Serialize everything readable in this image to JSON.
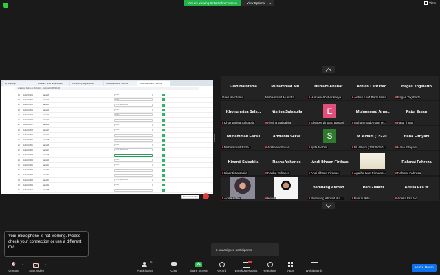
{
  "top": {
    "share_banner": "You are viewing Sinta Fahrur' screen",
    "view_options": "View Options",
    "view": "View"
  },
  "shared_screen": {
    "browser_tabs": [
      "(3) WhatsApp",
      "Dosdian - Sinta Tanya Scoveli",
      "OS tambungkungnatasi-rsa",
      "Universitas Bakrie - SIM Kis",
      "Universitas Bakrie - SIM Kis"
    ],
    "url": "academic.bakrie.ac.id/ubakrie_pim/nilai/10/4673/1200",
    "rows": [
      {
        "no": "16",
        "nim": "1202001001",
        "name": "Nama16",
        "select": "Lulus"
      },
      {
        "no": "17",
        "nim": "1202001002",
        "name": "Nama17",
        "select": "Lulus"
      },
      {
        "no": "18",
        "nim": "1202001003",
        "name": "Nama18",
        "select": "- Pilih Status Lulus -"
      },
      {
        "no": "19",
        "nim": "1202001004",
        "name": "Nama19",
        "select": "Lulus"
      },
      {
        "no": "20",
        "nim": "1202001005",
        "name": "Nama20",
        "select": "Lulus"
      },
      {
        "no": "21",
        "nim": "1202001006",
        "name": "Nama21",
        "select": "Lulus"
      },
      {
        "no": "22",
        "nim": "1202001007",
        "name": "Nama22",
        "select": "Lulus"
      },
      {
        "no": "23",
        "nim": "1202001008",
        "name": "Nama23",
        "select": "Lulus"
      },
      {
        "no": "24",
        "nim": "1202001009",
        "name": "Nama24",
        "select": "Lulus"
      },
      {
        "no": "25",
        "nim": "1202001010",
        "name": "Nama25",
        "select": "Lulus"
      },
      {
        "no": "26",
        "nim": "1202001011",
        "name": "Nama26",
        "select": "Lulus"
      },
      {
        "no": "27",
        "nim": "1202001012",
        "name": "Nama27",
        "select": "- Pilih Status Lulus -"
      },
      {
        "no": "28",
        "nim": "1202001013",
        "name": "Nama28",
        "select": "Lulus"
      },
      {
        "no": "29",
        "nim": "1202001014",
        "name": "Nama29",
        "select": "Lulus"
      },
      {
        "no": "30",
        "nim": "1202001015",
        "name": "Nama30",
        "select": "Lulus"
      },
      {
        "no": "31",
        "nim": "1202001016",
        "name": "Nama31",
        "select": "- Pilih Status Lulus -"
      },
      {
        "no": "32",
        "nim": "1202001017",
        "name": "Nama32",
        "select": "Lulus"
      },
      {
        "no": "33",
        "nim": "1202001018",
        "name": "Nama33",
        "select": "- Pilih Status Lulus -"
      },
      {
        "no": "34",
        "nim": "1202001019",
        "name": "Nama34",
        "select": "Lulus"
      },
      {
        "no": "35",
        "nim": "1202001020",
        "name": "Nama35",
        "select": "Lulus"
      }
    ],
    "save_label": "Simpan Hasil Ujian"
  },
  "participants": [
    {
      "center": "Glad Narotama",
      "label": "Glad Narotama",
      "muted": false
    },
    {
      "center": "Muhammad Mu...",
      "label": "Muhammad Mustofa",
      "muted": false
    },
    {
      "center": "Humam Abshar...",
      "label": "Humam Abshar karya",
      "muted": true
    },
    {
      "center": "Ardian Latif Bad...",
      "label": "Ardian Latif Badrutama",
      "muted": true
    },
    {
      "center": "Bagas Yogiharto",
      "label": "Bagas Yogiharto",
      "muted": true
    },
    {
      "center": "Khoirunnisa Sals...",
      "label": "Khoirunnisa Salsabila",
      "muted": true
    },
    {
      "center": "Nisrina Salsabila",
      "label": "Nisrina Salsabila",
      "muted": true
    },
    {
      "center": "",
      "label": "Elisabet Lintang Bastari",
      "muted": true,
      "avatar": "E"
    },
    {
      "center": "Muhammad Arun...",
      "label": "Muhammad Arung M...",
      "muted": true
    },
    {
      "center": "Fatur Ihsan",
      "label": "Fatur Ihsan",
      "muted": true
    },
    {
      "center": "Muhammad Faza I",
      "label": "Muhammad Faza I",
      "muted": true
    },
    {
      "center": "Addienia Sekar",
      "label": "Addienia Sekar",
      "muted": true
    },
    {
      "center": "",
      "label": "syifa fadhila",
      "muted": true,
      "avatar": "S"
    },
    {
      "center": "M. Alham (12220...",
      "label": "M. Alham (12220150...",
      "muted": true
    },
    {
      "center": "Hana Fitriyani",
      "label": "Hana Fitriyani",
      "muted": true
    },
    {
      "center": "Kinanti Salsabila",
      "label": "Kinanti Salsabila",
      "muted": true
    },
    {
      "center": "Rakha Yohanes",
      "label": "Rakha Yohanes",
      "muted": true
    },
    {
      "center": "Andi Ikhsan Firdaus",
      "label": "Andi Ikhsan Firdaus",
      "muted": true
    },
    {
      "center": "",
      "label": "Agatha Ivan Firmans...",
      "muted": true,
      "photo": "light"
    },
    {
      "center": "Rahmat Fahreza",
      "label": "Rahmat Fahreza",
      "muted": true
    },
    {
      "center": "",
      "label": "Aqilla Arifin",
      "muted": true,
      "video": "1"
    },
    {
      "center": "",
      "label": "Kevin",
      "muted": true,
      "video": "2"
    },
    {
      "center": "Bambang Ahmad...",
      "label": "Bambang Ahmaduha...",
      "muted": true
    },
    {
      "center": "Bari Zulkifli",
      "label": "Bari Zulkifli",
      "muted": true
    },
    {
      "center": "Adelia Eka W",
      "label": "Adelia Eka W",
      "muted": true
    }
  ],
  "mic_toast": "Your microphone is not working. Please check your connection or use a different mic.",
  "unassigned": "2 unassigned participants",
  "toolbar": {
    "unmute": "Unmute",
    "start_video": "Start Video",
    "participants": "Participants",
    "participants_count": "81",
    "chat": "Chat",
    "share_screen": "Share Screen",
    "record": "Record",
    "breakout_rooms": "Breakout Rooms",
    "reactions": "Reactions",
    "apps": "Apps",
    "whiteboards": "Whiteboards",
    "leave_room": "Leave Room"
  },
  "colors": {
    "accent_green": "#23b24b",
    "leave_blue": "#0e72ed",
    "muted_red": "#e63a3a"
  }
}
